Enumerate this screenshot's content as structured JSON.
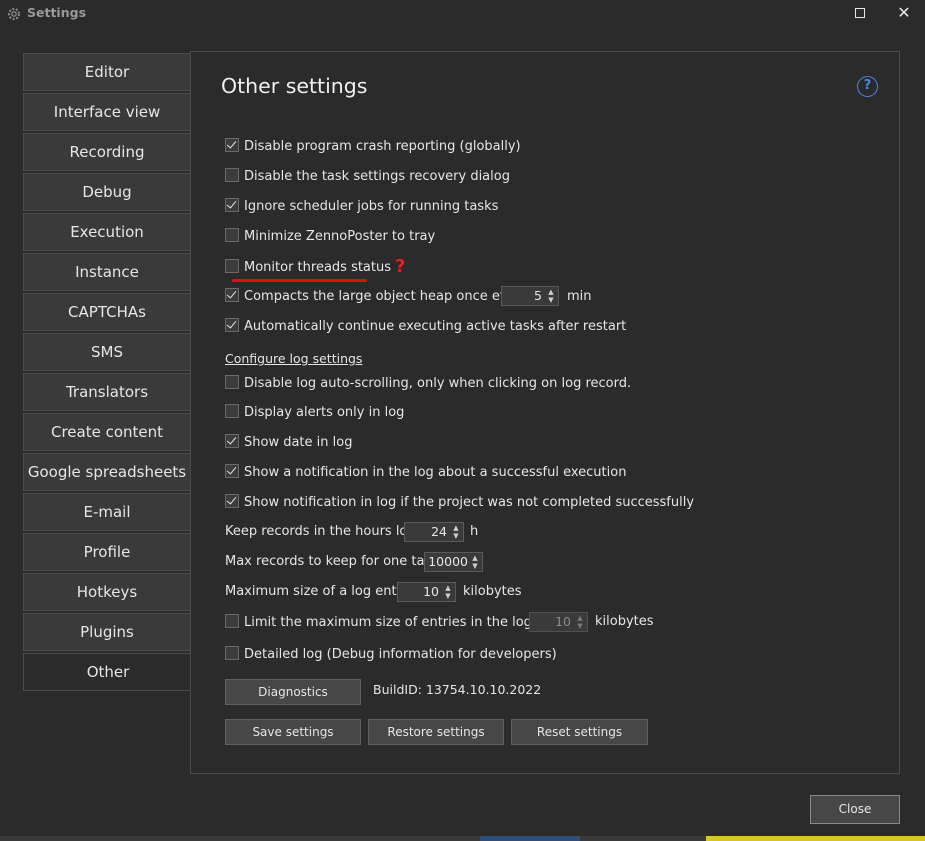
{
  "window": {
    "title": "Settings"
  },
  "sidebar": {
    "items": [
      {
        "label": "Editor"
      },
      {
        "label": "Interface view"
      },
      {
        "label": "Recording"
      },
      {
        "label": "Debug"
      },
      {
        "label": "Execution"
      },
      {
        "label": "Instance"
      },
      {
        "label": "CAPTCHAs"
      },
      {
        "label": "SMS"
      },
      {
        "label": "Translators"
      },
      {
        "label": "Create content"
      },
      {
        "label": "Google spreadsheets"
      },
      {
        "label": "E-mail"
      },
      {
        "label": "Profile"
      },
      {
        "label": "Hotkeys"
      },
      {
        "label": "Plugins"
      },
      {
        "label": "Other"
      }
    ],
    "active_index": 15
  },
  "panel": {
    "title": "Other settings",
    "help_icon_text": "?",
    "options": {
      "crash_reporting": {
        "label": "Disable program crash reporting (globally)",
        "checked": true
      },
      "recovery_dialog": {
        "label": "Disable the task settings recovery dialog",
        "checked": false
      },
      "ignore_scheduler": {
        "label": "Ignore scheduler jobs for running tasks",
        "checked": true
      },
      "minimize_tray": {
        "label": "Minimize ZennoPoster to tray",
        "checked": false
      },
      "monitor_threads": {
        "label": "Monitor threads status",
        "checked": false,
        "annotation": "?"
      },
      "compact_heap": {
        "label": "Compacts the large object heap once every",
        "checked": true,
        "value": "5",
        "unit": "min"
      },
      "auto_continue": {
        "label": "Automatically continue executing active tasks after restart",
        "checked": true
      }
    },
    "log_link": "Configure log settings",
    "log_options": {
      "disable_autoscroll": {
        "label": "Disable log auto-scrolling, only when clicking on log record.",
        "checked": false
      },
      "alerts_only": {
        "label": "Display alerts only in log",
        "checked": false
      },
      "show_date": {
        "label": "Show date in log",
        "checked": true
      },
      "notify_success": {
        "label": "Show a notification in the log about a successful execution",
        "checked": true
      },
      "notify_fail": {
        "label": "Show notification in log if the project was not completed successfully",
        "checked": true
      }
    },
    "hours_log": {
      "label": "Keep records in the hours log:",
      "value": "24",
      "unit": "h"
    },
    "max_records": {
      "label": "Max records to keep for one task:",
      "value": "10000"
    },
    "max_entry": {
      "label": "Maximum size of a log entry:",
      "value": "10",
      "unit": "kilobytes"
    },
    "limit_file": {
      "label": "Limit the maximum size of entries in the log file:",
      "checked": false,
      "value": "10",
      "unit": "kilobytes"
    },
    "detailed_log": {
      "label": "Detailed log (Debug information for developers)",
      "checked": false
    },
    "buttons": {
      "diagnostics": "Diagnostics",
      "build_id": "BuildID: 13754.10.10.2022",
      "save": "Save settings",
      "restore": "Restore settings",
      "reset": "Reset settings"
    }
  },
  "footer": {
    "close": "Close"
  },
  "colors": {
    "accent_help": "#4a86e8",
    "annotation_red": "#e02020",
    "bg": "#2b2b2b"
  }
}
